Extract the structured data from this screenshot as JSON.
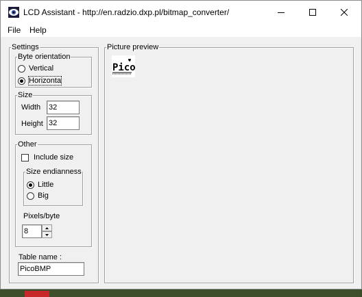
{
  "window": {
    "title": "LCD Assistant -  http://en.radzio.dxp.pl/bitmap_converter/",
    "icons": {
      "app": "lcd-eye-icon",
      "minimize": "minimize-icon",
      "maximize": "maximize-icon",
      "close": "close-icon"
    }
  },
  "menu": {
    "file": "File",
    "help": "Help"
  },
  "settings": {
    "legend": "Settings",
    "byte_orientation": {
      "legend": "Byte orientation",
      "vertical": "Vertical",
      "horizontal": "Horizonta",
      "selected": "horizontal"
    },
    "size": {
      "legend": "Size",
      "width_label": "Width",
      "width_value": "32",
      "height_label": "Height",
      "height_value": "32"
    },
    "other": {
      "legend": "Other",
      "include_size": "Include size",
      "include_size_checked": false,
      "endianness": {
        "legend": "Size endianness",
        "little": "Little",
        "big": "Big",
        "selected": "little"
      },
      "pixels_label": "Pixels/byte",
      "pixels_value": "8"
    },
    "table_name_label": "Table name :",
    "table_name_value": "PicoBMP"
  },
  "preview": {
    "legend": "Picture preview",
    "bitmap_text": "Pico"
  }
}
